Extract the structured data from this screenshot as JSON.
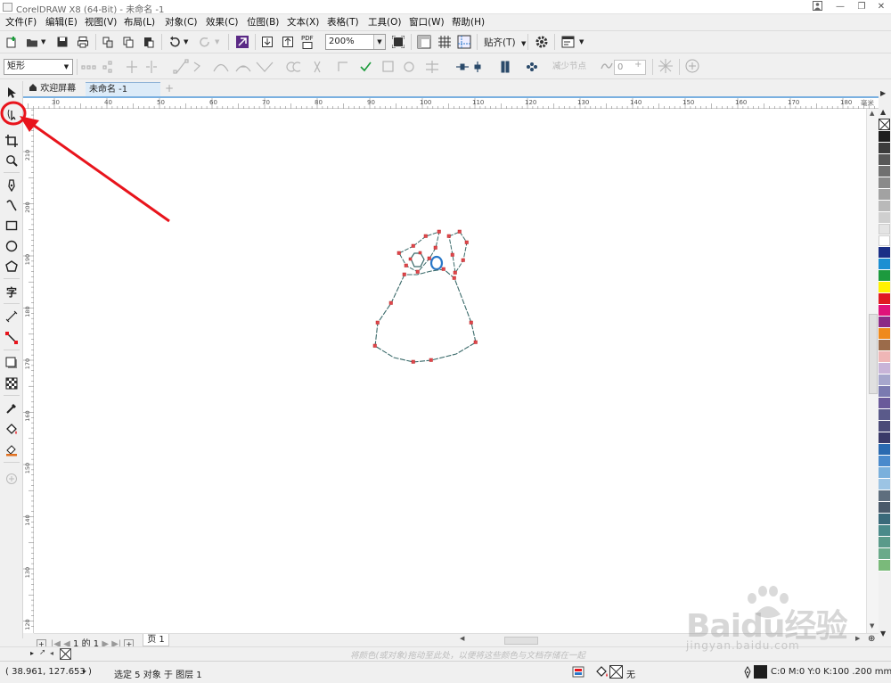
{
  "window": {
    "title": "CorelDRAW X8 (64-Bit) - 未命名 -1"
  },
  "menu": [
    "文件(F)",
    "编辑(E)",
    "视图(V)",
    "布局(L)",
    "对象(C)",
    "效果(C)",
    "位图(B)",
    "文本(X)",
    "表格(T)",
    "工具(O)",
    "窗口(W)",
    "帮助(H)"
  ],
  "toolbar": {
    "zoom": "200%",
    "snap_label": "贴齐(T)",
    "pdf_label": "PDF"
  },
  "propbar": {
    "shape_select": "矩形",
    "reduce_nodes": "减少节点",
    "curve_smooth": "0"
  },
  "tabs": {
    "home": "欢迎屏幕",
    "doc": "未命名 -1",
    "add": "+"
  },
  "ruler": {
    "h_ticks": [
      "30",
      "40",
      "50",
      "60",
      "70",
      "80",
      "90",
      "100",
      "110",
      "120",
      "130",
      "140",
      "150",
      "160",
      "170",
      "180"
    ],
    "unit": "毫米",
    "v_ticks": [
      "210",
      "200",
      "190",
      "180",
      "170",
      "160",
      "150",
      "140",
      "130",
      "120"
    ]
  },
  "pager": {
    "count": "1 的 1",
    "page_tab": "页 1"
  },
  "palette_hint": "将颜色(或对象)拖动至此处，以便将这些颜色与文档存储在一起",
  "status": {
    "coords": "( 38.961, 127.653 )",
    "selection": "选定 5 对象 于 图层 1",
    "fill": "无",
    "outline": "C:0 M:0 Y:0 K:100  .200 mm"
  },
  "watermark": {
    "brand": "Baidu经验",
    "url": "jingyan.baidu.com"
  },
  "colors": {
    "accent_tab": "#dcebf8",
    "annotation": "#e8141c",
    "node": "#e0474c",
    "outline": "#3a6a6a",
    "blue_shape": "#2a78c8",
    "palette": [
      "#1e1e1e",
      "#3c3c3c",
      "#585858",
      "#707070",
      "#8a8a8a",
      "#a2a2a2",
      "#b9b9b9",
      "#cfcfcf",
      "#e4e4e4",
      "#ffffff",
      "#1b2f86",
      "#1b8fd2",
      "#1c9a3e",
      "#fff200",
      "#e01a22",
      "#e0127a",
      "#8c2a86",
      "#ef8a1c",
      "#9b6b4a",
      "#efb6b6",
      "#c8b4d8",
      "#a6a6cc",
      "#7a7ab0",
      "#6a5a9a",
      "#5a5a8a",
      "#4a4a78",
      "#3a3a68",
      "#2a6ab0",
      "#4a8acc",
      "#7ab0dc",
      "#9cc4e4",
      "#5e6e7e",
      "#4a5a6a",
      "#3a6a7a",
      "#4a8a8a",
      "#5a9a8a",
      "#6aaa8a",
      "#7aba7a"
    ]
  }
}
